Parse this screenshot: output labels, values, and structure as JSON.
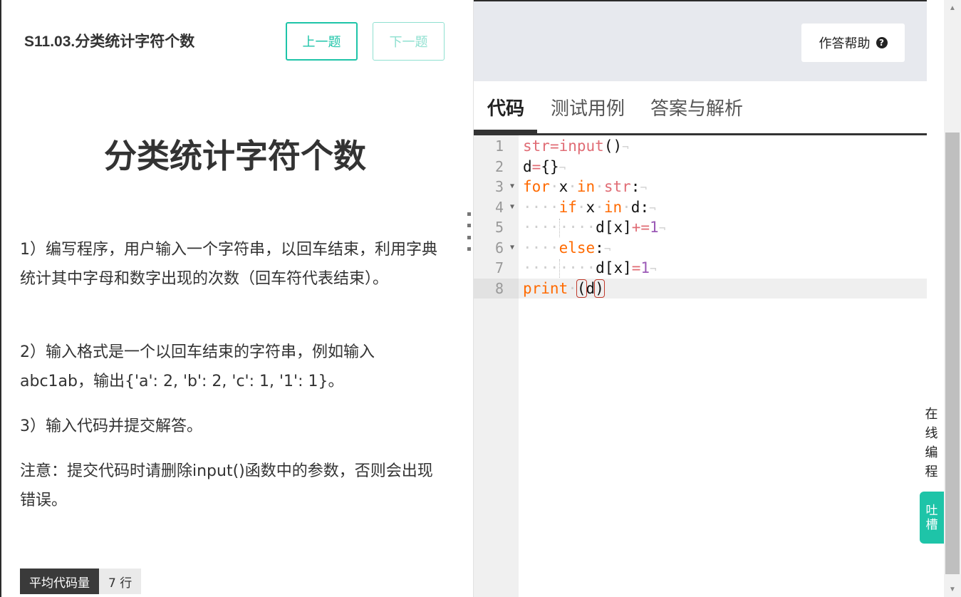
{
  "header": {
    "problem_code": "S11.03.分类统计字符个数",
    "prev_button": "上一题",
    "next_button": "下一题",
    "help_button": "作答帮助"
  },
  "problem": {
    "title": "分类统计字符个数",
    "descriptions": [
      "1）编写程序，用户输入一个字符串，以回车结束，利用字典统计其中字母和数字出现的次数（回车符代表结束）。",
      "2）输入格式是一个以回车结束的字符串，例如输入abc1ab，输出{'a': 2, 'b': 2, 'c': 1, '1': 1}。",
      "3）输入代码并提交解答。",
      "注意：提交代码时请删除input()函数中的参数，否则会出现错误。"
    ],
    "stat_label": "平均代码量",
    "stat_value": "7 行"
  },
  "tabs": [
    {
      "label": "代码",
      "active": true
    },
    {
      "label": "测试用例",
      "active": false
    },
    {
      "label": "答案与解析",
      "active": false
    }
  ],
  "editor": {
    "line_numbers": [
      "1",
      "2",
      "3",
      "4",
      "5",
      "6",
      "7",
      "8"
    ],
    "active_line": 8,
    "lines": [
      "str=input()",
      "d={}",
      "for x in str:",
      "    if x in d:",
      "        d[x]+=1",
      "    else:",
      "        d[x]=1",
      "print (d)"
    ]
  },
  "side": {
    "online_coding_chars": [
      "在",
      "线",
      "编",
      "程"
    ],
    "feedback_chars": [
      "吐",
      "槽"
    ]
  },
  "colors": {
    "accent": "#1ec4a8",
    "keyword": "#ff6a00",
    "builtin": "#e06c75",
    "number": "#9b59b6"
  },
  "icons": {
    "help": "question-circle-icon",
    "fold": "triangle-down-icon",
    "splitter": "drag-dots-icon"
  }
}
